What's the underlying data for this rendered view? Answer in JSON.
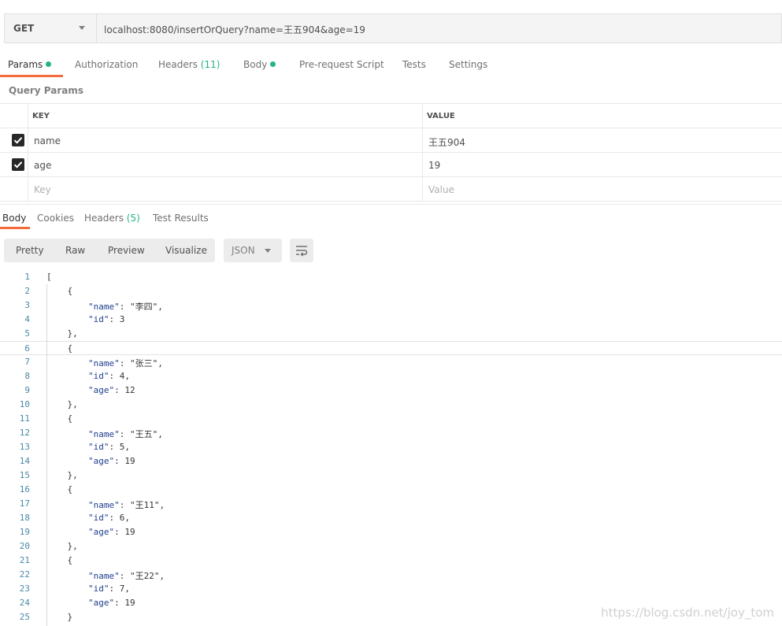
{
  "request": {
    "method": "GET",
    "url": "localhost:8080/insertOrQuery?name=王五904&age=19"
  },
  "request_tabs": [
    {
      "label": "Params",
      "dot": true,
      "count": ""
    },
    {
      "label": "Authorization",
      "dot": false,
      "count": ""
    },
    {
      "label": "Headers",
      "dot": false,
      "count": "(11)"
    },
    {
      "label": "Body",
      "dot": true,
      "count": ""
    },
    {
      "label": "Pre-request Script",
      "dot": false,
      "count": ""
    },
    {
      "label": "Tests",
      "dot": false,
      "count": ""
    },
    {
      "label": "Settings",
      "dot": false,
      "count": ""
    }
  ],
  "query_params": {
    "title": "Query Params",
    "header_key": "KEY",
    "header_value": "VALUE",
    "rows": [
      {
        "checked": true,
        "key": "name",
        "value": "王五904"
      },
      {
        "checked": true,
        "key": "age",
        "value": "19"
      }
    ],
    "placeholder_key": "Key",
    "placeholder_value": "Value"
  },
  "response_tabs": [
    {
      "label": "Body",
      "count": ""
    },
    {
      "label": "Cookies",
      "count": ""
    },
    {
      "label": "Headers",
      "count": "(5)"
    },
    {
      "label": "Test Results",
      "count": ""
    }
  ],
  "view_modes": [
    "Pretty",
    "Raw",
    "Preview",
    "Visualize"
  ],
  "format": "JSON",
  "icons": {
    "wrap": "wrap-lines-icon",
    "check": "check-icon",
    "caret": "chevron-down-icon"
  },
  "colors": {
    "accent": "#f26b3a",
    "green": "#26b47f"
  },
  "code_lines": [
    {
      "n": "1",
      "t": "["
    },
    {
      "n": "2",
      "t": "    {"
    },
    {
      "n": "3",
      "t": "        \"name\": \"李四\","
    },
    {
      "n": "4",
      "t": "        \"id\": 3"
    },
    {
      "n": "5",
      "t": "    },"
    },
    {
      "n": "6",
      "t": "    {"
    },
    {
      "n": "7",
      "t": "        \"name\": \"张三\","
    },
    {
      "n": "8",
      "t": "        \"id\": 4,"
    },
    {
      "n": "9",
      "t": "        \"age\": 12"
    },
    {
      "n": "10",
      "t": "    },"
    },
    {
      "n": "11",
      "t": "    {"
    },
    {
      "n": "12",
      "t": "        \"name\": \"王五\","
    },
    {
      "n": "13",
      "t": "        \"id\": 5,"
    },
    {
      "n": "14",
      "t": "        \"age\": 19"
    },
    {
      "n": "15",
      "t": "    },"
    },
    {
      "n": "16",
      "t": "    {"
    },
    {
      "n": "17",
      "t": "        \"name\": \"王11\","
    },
    {
      "n": "18",
      "t": "        \"id\": 6,"
    },
    {
      "n": "19",
      "t": "        \"age\": 19"
    },
    {
      "n": "20",
      "t": "    },"
    },
    {
      "n": "21",
      "t": "    {"
    },
    {
      "n": "22",
      "t": "        \"name\": \"王22\","
    },
    {
      "n": "23",
      "t": "        \"id\": 7,"
    },
    {
      "n": "24",
      "t": "        \"age\": 19"
    },
    {
      "n": "25",
      "t": "    }"
    }
  ],
  "watermark": "https://blog.csdn.net/joy_tom"
}
